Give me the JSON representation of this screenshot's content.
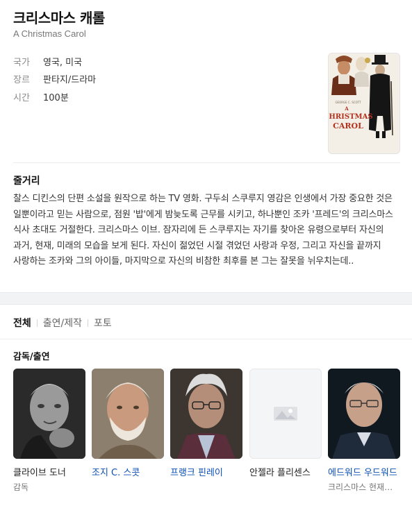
{
  "movie": {
    "title": "크리스마스 캐롤",
    "subtitle": "A Christmas Carol",
    "info": [
      {
        "key": "국가",
        "value": "영국, 미국"
      },
      {
        "key": "장르",
        "value": "판타지/드라마"
      },
      {
        "key": "시간",
        "value": "100분"
      }
    ],
    "poster": {
      "credit": "GEORGE C. SCOTT",
      "line1": "A",
      "line2": "CHRISTMAS",
      "line3": "CAROL"
    }
  },
  "synopsis": {
    "heading": "줄거리",
    "text": "찰스 디킨스의 단편 소설을 원작으로 하는 TV 영화. 구두쇠 스쿠루지 영감은 인생에서 가장 중요한 것은 일뿐이라고 믿는 사람으로, 점원 '밥'에게 밤늦도록 근무를 시키고, 하나뿐인 조카 '프레드'의 크리스마스 식사 초대도 거절한다. 크리스마스 이브. 잠자리에 든 스쿠루지는 자기를 찾아온 유령으로부터 자신의 과거, 현재, 미래의 모습을 보게 된다. 자신이 젊었던 시절 겪었던 사랑과 우정, 그리고 자신을 끝까지 사랑하는 조카와 그의 아이들, 마지막으로 자신의 비참한 최후를 본 그는 잘못을 뉘우치는데.."
  },
  "tabs": [
    "전체",
    "출연/제작",
    "포토"
  ],
  "cast": {
    "heading": "감독/출연",
    "people": [
      {
        "name": "클라이브 도너",
        "role": "감독",
        "has_photo": true
      },
      {
        "name": "조지 C. 스콧",
        "role": "",
        "has_photo": true
      },
      {
        "name": "프랭크 핀레이",
        "role": "",
        "has_photo": true
      },
      {
        "name": "안젤라 플리센스",
        "role": "",
        "has_photo": false,
        "icon": "image-placeholder-icon"
      },
      {
        "name": "에드워드 우드워드",
        "role": "크리스마스 현재의 유령",
        "has_photo": true
      }
    ]
  },
  "colors": {
    "link": "#0b4fb4",
    "muted": "#8a8a8a",
    "background": "#f1f3f5"
  }
}
